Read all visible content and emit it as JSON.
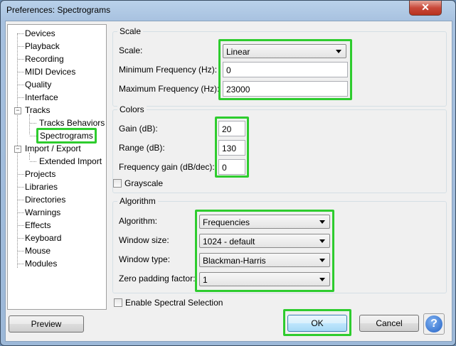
{
  "window": {
    "title": "Preferences: Spectrograms",
    "close_glyph": "✕"
  },
  "tree": {
    "items": [
      {
        "label": "Devices"
      },
      {
        "label": "Playback"
      },
      {
        "label": "Recording"
      },
      {
        "label": "MIDI Devices"
      },
      {
        "label": "Quality"
      },
      {
        "label": "Interface"
      },
      {
        "label": "Tracks"
      },
      {
        "label": "Tracks Behaviors"
      },
      {
        "label": "Spectrograms"
      },
      {
        "label": "Import / Export"
      },
      {
        "label": "Extended Import"
      },
      {
        "label": "Projects"
      },
      {
        "label": "Libraries"
      },
      {
        "label": "Directories"
      },
      {
        "label": "Warnings"
      },
      {
        "label": "Effects"
      },
      {
        "label": "Keyboard"
      },
      {
        "label": "Mouse"
      },
      {
        "label": "Modules"
      }
    ],
    "expander_glyph": "−"
  },
  "scale": {
    "group_label": "Scale",
    "scale_label": "Scale:",
    "scale_value": "Linear",
    "min_label": "Minimum Frequency (Hz):",
    "min_value": "0",
    "max_label": "Maximum Frequency (Hz):",
    "max_value": "23000"
  },
  "colors": {
    "group_label": "Colors",
    "gain_label": "Gain (dB):",
    "gain_value": "20",
    "range_label": "Range (dB):",
    "range_value": "130",
    "freqgain_label": "Frequency gain (dB/dec):",
    "freqgain_value": "0",
    "grayscale_label": "Grayscale"
  },
  "algorithm": {
    "group_label": "Algorithm",
    "algorithm_label": "Algorithm:",
    "algorithm_value": "Frequencies",
    "window_size_label": "Window size:",
    "window_size_value": "1024 - default",
    "window_type_label": "Window type:",
    "window_type_value": "Blackman-Harris",
    "zero_padding_label": "Zero padding factor:",
    "zero_padding_value": "1"
  },
  "spectral_selection_label": "Enable Spectral Selection",
  "buttons": {
    "preview": "Preview",
    "ok": "OK",
    "cancel": "Cancel",
    "help": "?"
  },
  "colors_theme": {
    "highlight": "#2ecc2e",
    "close": "#c9493a",
    "help": "#2463c6"
  }
}
